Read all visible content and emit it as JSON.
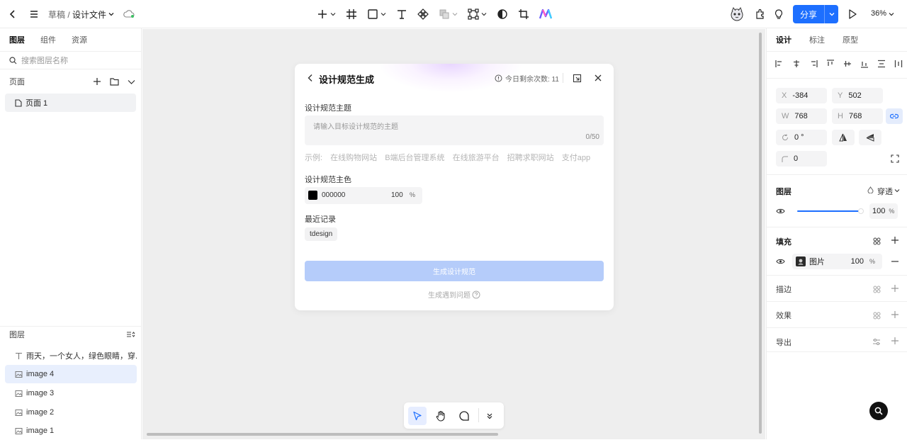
{
  "topbar": {
    "breadcrumb_parent": "草稿",
    "breadcrumb_sep": "/",
    "file_name": "设计文件",
    "share_label": "分享",
    "zoom": "36%"
  },
  "left_panel": {
    "tabs": [
      "图层",
      "组件",
      "资源"
    ],
    "search_placeholder": "搜索图层名称",
    "pages_title": "页面",
    "pages": [
      "页面 1"
    ],
    "layers_title": "图层",
    "layers": [
      {
        "name": "雨天，一个女人，绿色眼睛，穿...",
        "kind": "text"
      },
      {
        "name": "image 4",
        "kind": "image",
        "selected": true
      },
      {
        "name": "image 3",
        "kind": "image"
      },
      {
        "name": "image 2",
        "kind": "image"
      },
      {
        "name": "image 1",
        "kind": "image"
      }
    ]
  },
  "dialog": {
    "title": "设计规范生成",
    "quota": "今日剩余次数: 11",
    "topic_label": "设计规范主题",
    "topic_placeholder": "请输入目标设计规范的主题",
    "topic_counter": "0/50",
    "examples_prefix": "示例:",
    "examples": [
      "在线购物网站",
      "B端后台管理系统",
      "在线旅游平台",
      "招聘求职网站",
      "支付app"
    ],
    "color_label": "设计规范主色",
    "color_hex": "000000",
    "color_value": "#000000",
    "color_opacity": "100",
    "color_opacity_unit": "%",
    "recent_label": "最近记录",
    "recent_tags": [
      "tdesign"
    ],
    "generate_label": "生成设计规范",
    "help_label": "生成遇到问题"
  },
  "right_panel": {
    "tabs": [
      "设计",
      "标注",
      "原型"
    ],
    "x": {
      "key": "X",
      "value": "-384"
    },
    "y": {
      "key": "Y",
      "value": "502"
    },
    "w": {
      "key": "W",
      "value": "768"
    },
    "h": {
      "key": "H",
      "value": "768"
    },
    "rotation": "0 °",
    "radius": "0",
    "layer_title": "图层",
    "blend_mode": "穿透",
    "layer_opacity": "100",
    "layer_opacity_unit": "%",
    "layer_opacity_fraction": 1.0,
    "fill_title": "填充",
    "fill_type": "图片",
    "fill_opacity": "100",
    "fill_opacity_unit": "%",
    "stroke_title": "描边",
    "effect_title": "效果",
    "export_title": "导出"
  },
  "colors": {
    "accent": "#1d6fff",
    "generate_disabled": "#b5ccfa",
    "canvas": "#eeeeee"
  }
}
